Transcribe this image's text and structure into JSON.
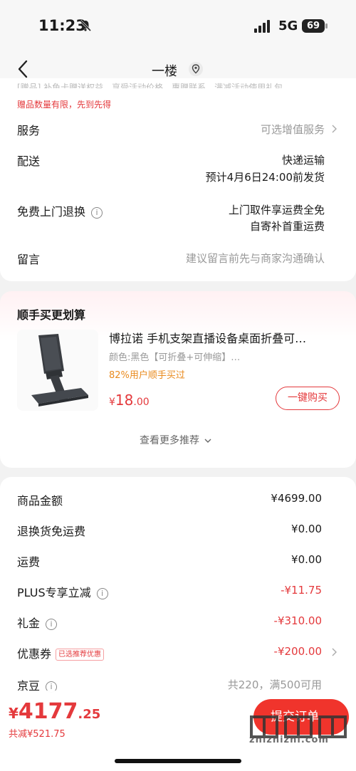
{
  "status_bar": {
    "time": "11:23",
    "network": "5G",
    "battery": "69"
  },
  "nav": {
    "title": "一楼"
  },
  "order_info": {
    "gift_note_cut": "[赠品] 补鱼卡赠送权益，享受活动价格，惠赠联系，满减活动使用礼包",
    "gift_note": "赠品数量有限，先到先得",
    "service": {
      "label": "服务",
      "value": "可选增值服务"
    },
    "delivery": {
      "label": "配送",
      "value_line1": "快递运输",
      "value_line2": "预计4月6日24:00前发货"
    },
    "free_return": {
      "label": "免费上门退换",
      "value_line1": "上门取件享运费全免",
      "value_line2": "自寄补首重运费"
    },
    "message": {
      "label": "留言",
      "placeholder": "建议留言前先与商家沟通确认"
    }
  },
  "addon": {
    "title": "顺手买更划算",
    "product": {
      "name": "博拉诺 手机支架直播设备桌面折叠可…",
      "spec": "颜色:黑色【可折叠+可伸缩】…",
      "rate": "82%用户顺手买过",
      "price_currency": "¥",
      "price_int": "18",
      "price_dec": ".00",
      "buy_label": "一键购买"
    },
    "more_label": "查看更多推荐"
  },
  "summary": {
    "rows": [
      {
        "label": "商品金额",
        "value": "¥4699.00"
      },
      {
        "label": "退换货免运费",
        "value": "¥0.00"
      },
      {
        "label": "运费",
        "value": "¥0.00"
      },
      {
        "label": "PLUS专享立减",
        "value": "-¥11.75"
      },
      {
        "label": "礼金",
        "value": "-¥310.00"
      },
      {
        "label": "优惠券",
        "badge": "已选推荐优惠",
        "value": "-¥200.00"
      },
      {
        "label": "京豆",
        "value": "共220，满500可用"
      }
    ]
  },
  "bottom": {
    "total_currency": "¥",
    "total_int": "4177",
    "total_dec": ".25",
    "saving": "共减¥521.75",
    "submit_label": "提交订单",
    "watermark": "zhizhizhi.com"
  },
  "colors": {
    "accent": "#e4393c",
    "button": "#f0342c",
    "highlight": "#e98b1f"
  },
  "icons": [
    "bell-slash-icon",
    "signal-icon",
    "back-icon",
    "location-icon",
    "chevron-right-icon",
    "info-icon",
    "chevron-down-icon"
  ]
}
